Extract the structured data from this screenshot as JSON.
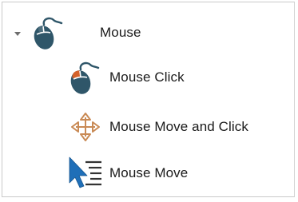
{
  "tree": {
    "root": {
      "label": "Mouse",
      "icon": "mouse-icon",
      "expanded": true
    },
    "children": [
      {
        "label": "Mouse Click",
        "icon": "mouse-left-click-icon"
      },
      {
        "label": "Mouse Move and Click",
        "icon": "move-arrows-icon"
      },
      {
        "label": "Mouse Move",
        "icon": "cursor-list-icon"
      }
    ]
  },
  "colors": {
    "mouse_body": "#2f5669",
    "mouse_click_highlight": "#d4622a",
    "move_arrows": "#c98a55",
    "cursor_blue": "#1f6fb8",
    "text": "#1a1a1a",
    "border": "#c9c9c9",
    "expander": "#6e6e6e"
  }
}
